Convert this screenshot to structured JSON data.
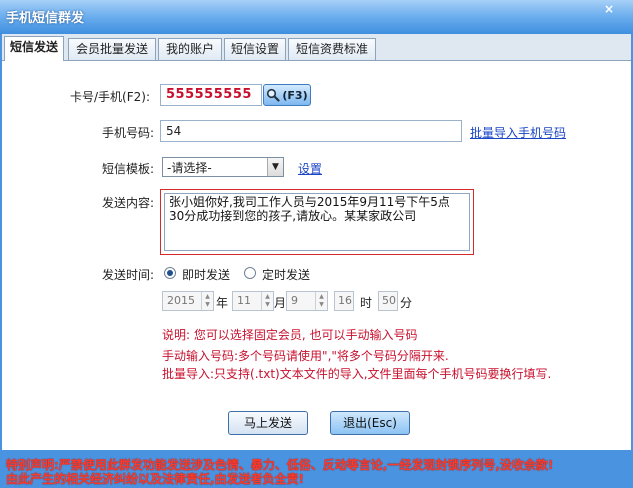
{
  "window": {
    "title": "手机短信群发",
    "close_label": "×"
  },
  "tabs": [
    {
      "label": "短信发送",
      "active": true
    },
    {
      "label": "会员批量发送",
      "active": false
    },
    {
      "label": "我的账户",
      "active": false
    },
    {
      "label": "短信设置",
      "active": false
    },
    {
      "label": "短信资费标准",
      "active": false
    }
  ],
  "form": {
    "card_label": "卡号/手机(F2):",
    "card_value": "555555555",
    "search_button_label": "(F3)",
    "phone_label": "手机号码:",
    "phone_value": "54",
    "batch_import_link": "批量导入手机号码",
    "template_label": "短信模板:",
    "template_selected": "-请选择-",
    "settings_link": "设置",
    "content_label": "发送内容:",
    "content_value": "张小姐你好,我司工作人员与2015年9月11号下午5点30分成功接到您的孩子,请放心。某某家政公司",
    "time_label": "发送时间:",
    "send_now_label": "即时发送",
    "schedule_label": "定时发送",
    "send_mode": "即时发送",
    "year_value": "2015",
    "year_unit": "年",
    "month_value": "11",
    "month_unit": "月",
    "day_value": "9",
    "hour_value": "16",
    "hour_unit": "时",
    "minute_value": "50",
    "minute_unit": "分"
  },
  "notes": [
    "说明: 您可以选择固定会员, 也可以手动输入号码",
    "手动输入号码:多个号码请使用\",\"将多个号码分隔开来.",
    "批量导入:只支持(.txt)文本文件的导入,文件里面每个手机号码要换行填写."
  ],
  "buttons": {
    "send_label": "马上发送",
    "exit_label": "退出(Esc)"
  },
  "footer": {
    "line1": "特别声明:严禁使用此群发功能发送涉及色情、暴力、低俗、反动等言论,一经发现封锁序列号,没收余款!",
    "line2": "由此产生的相关经济纠纷以及法律责任,由发送者负全责!"
  },
  "colors": {
    "title_bar": "#4a93e0",
    "warning": "#ff3a2a",
    "note": "#c8102e",
    "link": "#1a45c4"
  }
}
